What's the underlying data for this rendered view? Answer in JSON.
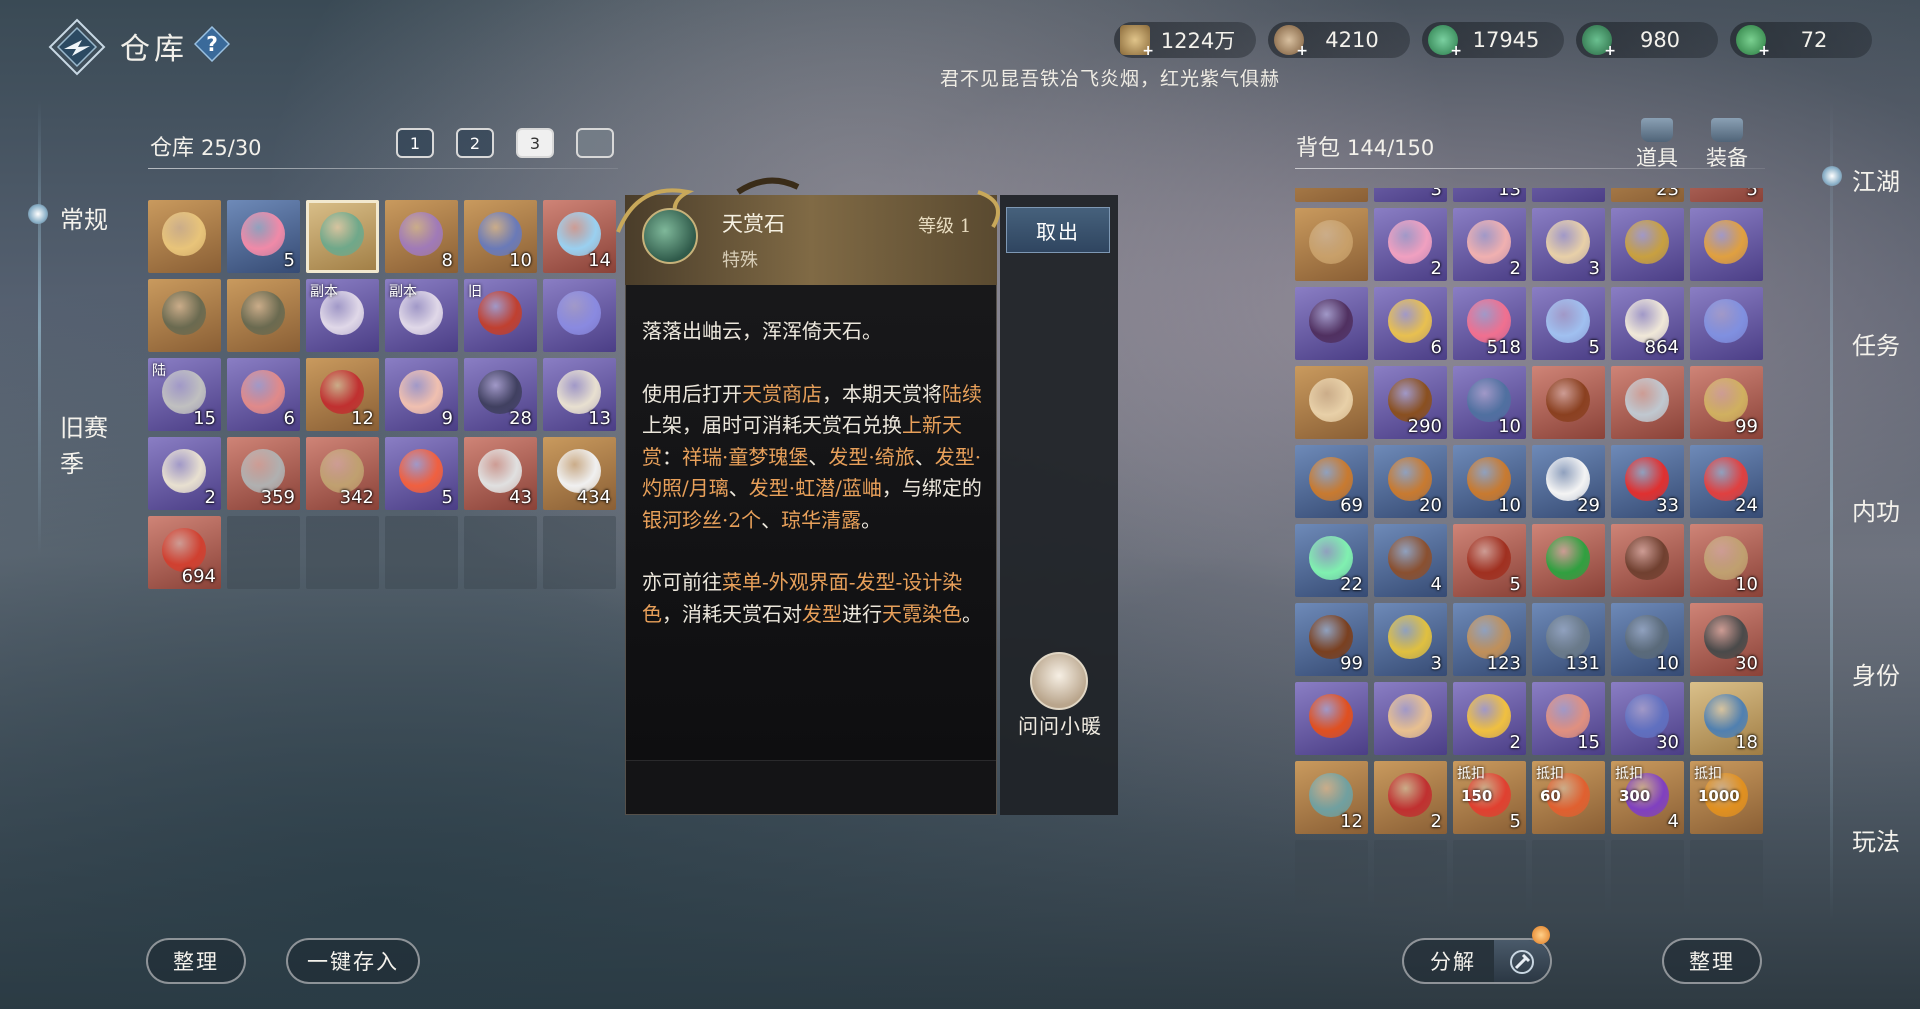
{
  "header": {
    "title": "仓库",
    "help_icon": "question-icon",
    "currencies": [
      {
        "name": "scroll-currency-icon",
        "value": "1224万",
        "color": "#c6a26a"
      },
      {
        "name": "coin-currency-icon",
        "value": "4210",
        "color": "#a98b6a"
      },
      {
        "name": "jade-currency-icon-1",
        "value": "17945",
        "color": "#3d9a6a"
      },
      {
        "name": "jade-currency-icon-2",
        "value": "980",
        "color": "#3d8a5a"
      },
      {
        "name": "jade-currency-icon-3",
        "value": "72",
        "color": "#4a9a5a"
      }
    ],
    "poem": "君不见昆吾铁冶飞炎烟，红光紫气俱赫"
  },
  "left_nav": {
    "items": [
      {
        "label": "常规",
        "active": true
      },
      {
        "label": "旧赛季"
      }
    ]
  },
  "warehouse": {
    "label": "仓库",
    "count": "25/30",
    "tabs": [
      "1",
      "2",
      "3",
      ""
    ],
    "slots": [
      {
        "rarity": "orange",
        "icon": "ring-icon",
        "qty": "",
        "color": "#e8c47a"
      },
      {
        "rarity": "blue",
        "icon": "hearts-icon",
        "qty": "5",
        "color": "#f08aa8"
      },
      {
        "rarity": "gold",
        "icon": "tianshang-stone-icon",
        "qty": "",
        "selected": true,
        "color": "#6fa88a"
      },
      {
        "rarity": "orange",
        "icon": "token-icon",
        "qty": "8",
        "color": "#a07ab8"
      },
      {
        "rarity": "orange",
        "icon": "badge-icon",
        "qty": "10",
        "color": "#6a7ab8"
      },
      {
        "rarity": "red",
        "icon": "crystal-icon",
        "qty": "14",
        "color": "#9ad0f0"
      },
      {
        "rarity": "orange",
        "icon": "ore-icon",
        "qty": "",
        "color": "#6a6a50"
      },
      {
        "rarity": "orange",
        "icon": "ore-icon",
        "qty": "",
        "color": "#6a6a50"
      },
      {
        "rarity": "purple",
        "icon": "robe-icon",
        "qty": "",
        "tag": "副本",
        "color": "#e0d8e8"
      },
      {
        "rarity": "purple",
        "icon": "robe-icon",
        "qty": "",
        "tag": "副本",
        "color": "#e0d8e8"
      },
      {
        "rarity": "purple",
        "icon": "pouch-icon",
        "qty": "",
        "tag": "旧",
        "color": "#c04030"
      },
      {
        "rarity": "purple",
        "icon": "orb-icon",
        "qty": "",
        "color": "#8a8ae0"
      },
      {
        "rarity": "purple",
        "icon": "lantern-icon",
        "qty": "15",
        "tag": "陆",
        "color": "#c0c0c0"
      },
      {
        "rarity": "purple",
        "icon": "scroll-icon",
        "qty": "6",
        "color": "#e08a8a"
      },
      {
        "rarity": "orange",
        "icon": "envelope-icon",
        "qty": "12",
        "color": "#c03030"
      },
      {
        "rarity": "purple",
        "icon": "pearl-icon",
        "qty": "9",
        "color": "#f0c0b0"
      },
      {
        "rarity": "purple",
        "icon": "book-icon",
        "qty": "28",
        "color": "#404060"
      },
      {
        "rarity": "purple",
        "icon": "book-icon",
        "qty": "13",
        "color": "#e8e0d0"
      },
      {
        "rarity": "purple",
        "icon": "book-icon",
        "qty": "2",
        "color": "#e8e0d0"
      },
      {
        "rarity": "red",
        "icon": "book-icon",
        "qty": "359",
        "color": "#b0b0b0"
      },
      {
        "rarity": "red",
        "icon": "bowl-icon",
        "qty": "342",
        "color": "#c0a070"
      },
      {
        "rarity": "purple",
        "icon": "lotus-icon",
        "qty": "5",
        "color": "#f06040"
      },
      {
        "rarity": "red",
        "icon": "fish-icon",
        "qty": "43",
        "color": "#e0e0e0"
      },
      {
        "rarity": "orange",
        "icon": "crane-icon",
        "qty": "434",
        "color": "#f0f0f0"
      },
      {
        "rarity": "red",
        "icon": "gourd-icon",
        "qty": "694",
        "color": "#d04030"
      },
      {
        "empty": true
      },
      {
        "empty": true
      },
      {
        "empty": true
      },
      {
        "empty": true
      },
      {
        "empty": true
      }
    ]
  },
  "tooltip": {
    "name": "天赏石",
    "type": "特殊",
    "level": "等级 1",
    "take_out": "取出",
    "para1": "落落出岫云，浑浑倚天石。",
    "para2_segments": [
      {
        "t": "使用后打开"
      },
      {
        "t": "天赏商店",
        "c": "orange"
      },
      {
        "t": "，本期天赏将"
      },
      {
        "t": "陆续",
        "c": "orange"
      },
      {
        "t": "上架，届时可消耗天赏石兑换"
      },
      {
        "t": "上新天赏",
        "c": "orange"
      },
      {
        "t": "："
      },
      {
        "t": "祥瑞·童梦瑰堡",
        "c": "orange"
      },
      {
        "t": "、"
      },
      {
        "t": "发型·绮旅",
        "c": "orange"
      },
      {
        "t": "、"
      },
      {
        "t": "发型·灼照/月璃",
        "c": "orange"
      },
      {
        "t": "、"
      },
      {
        "t": "发型·虹潜/蓝岫",
        "c": "orange"
      },
      {
        "t": "，与绑定的"
      },
      {
        "t": "银河珍丝·2个",
        "c": "orange"
      },
      {
        "t": "、"
      },
      {
        "t": "琼华清露",
        "c": "orange"
      },
      {
        "t": "。"
      }
    ],
    "para3_segments": [
      {
        "t": "亦可前往"
      },
      {
        "t": "菜单-外观界面-发型-设计染色",
        "c": "orange"
      },
      {
        "t": "，消耗天赏石对"
      },
      {
        "t": "发型",
        "c": "orange"
      },
      {
        "t": "进行"
      },
      {
        "t": "天霓染色",
        "c": "orange"
      },
      {
        "t": "。"
      }
    ],
    "ask_label": "问问小暖"
  },
  "bag": {
    "label": "背包",
    "count": "144/150",
    "tabs": [
      "道具",
      "装备"
    ],
    "top_partial_qty": [
      "",
      "3",
      "13",
      "",
      "23",
      "5"
    ],
    "slots": [
      {
        "rarity": "orange",
        "icon": "paper-icon",
        "qty": "",
        "color": "#c8a06a"
      },
      {
        "rarity": "purple",
        "icon": "crystal-ball-icon",
        "qty": "2",
        "color": "#f0a0c0"
      },
      {
        "rarity": "purple",
        "icon": "crystal-ball-icon",
        "qty": "2",
        "color": "#f0b0b0"
      },
      {
        "rarity": "purple",
        "icon": "scroll-icon",
        "qty": "3",
        "color": "#e8d0a8"
      },
      {
        "rarity": "purple",
        "icon": "money-bag-icon",
        "qty": "",
        "color": "#c8a040"
      },
      {
        "rarity": "purple",
        "icon": "charm-icon",
        "qty": "",
        "color": "#e0a040"
      },
      {
        "rarity": "purple",
        "icon": "box-icon",
        "qty": "",
        "color": "#503060"
      },
      {
        "rarity": "purple",
        "icon": "gold-coin-icon",
        "qty": "6",
        "color": "#e8c050"
      },
      {
        "rarity": "purple",
        "icon": "pink-orb-icon",
        "qty": "518",
        "color": "#f07090"
      },
      {
        "rarity": "purple",
        "icon": "gem-icon",
        "qty": "5",
        "color": "#a0c0f0"
      },
      {
        "rarity": "purple",
        "icon": "mask-icon",
        "qty": "864",
        "color": "#f0e8d8"
      },
      {
        "rarity": "purple",
        "icon": "ticket-icon",
        "qty": "",
        "color": "#8090e0"
      },
      {
        "rarity": "orange",
        "icon": "scroll-icon",
        "qty": "",
        "color": "#e8d0a8"
      },
      {
        "rarity": "purple",
        "icon": "chest-icon",
        "qty": "290",
        "color": "#8a5020"
      },
      {
        "rarity": "purple",
        "icon": "book-icon",
        "qty": "10",
        "color": "#5070a0"
      },
      {
        "rarity": "red",
        "icon": "bowl-icon",
        "qty": "",
        "color": "#8a4020"
      },
      {
        "rarity": "red",
        "icon": "vase-icon",
        "qty": "",
        "color": "#c0c8d0"
      },
      {
        "rarity": "red",
        "icon": "brush-icon",
        "qty": "99",
        "color": "#d0b060"
      },
      {
        "rarity": "blue",
        "icon": "seal-icon",
        "qty": "69",
        "color": "#c87a30"
      },
      {
        "rarity": "blue",
        "icon": "seal-icon",
        "qty": "20",
        "color": "#c87a30"
      },
      {
        "rarity": "blue",
        "icon": "seal-icon",
        "qty": "10",
        "color": "#c87a30"
      },
      {
        "rarity": "blue",
        "icon": "face-icon",
        "qty": "29",
        "color": "#f4f4f4"
      },
      {
        "rarity": "blue",
        "icon": "firework-icon",
        "qty": "33",
        "color": "#e03030"
      },
      {
        "rarity": "blue",
        "icon": "demon-icon",
        "qty": "24",
        "color": "#e04040"
      },
      {
        "rarity": "blue",
        "icon": "glowstick-icon",
        "qty": "22",
        "color": "#80f0b0"
      },
      {
        "rarity": "blue",
        "icon": "wood-icon",
        "qty": "4",
        "color": "#8a5030"
      },
      {
        "rarity": "red",
        "icon": "tag-icon",
        "qty": "5",
        "color": "#a03020"
      },
      {
        "rarity": "red",
        "icon": "holly-icon",
        "qty": "",
        "color": "#30a040"
      },
      {
        "rarity": "red",
        "icon": "branch-icon",
        "qty": "",
        "color": "#704030"
      },
      {
        "rarity": "red",
        "icon": "bowl-icon",
        "qty": "10",
        "color": "#c0a070"
      },
      {
        "rarity": "blue",
        "icon": "bowl-icon",
        "qty": "99",
        "color": "#7a4020"
      },
      {
        "rarity": "blue",
        "icon": "candy-icon",
        "qty": "3",
        "color": "#e0c040"
      },
      {
        "rarity": "blue",
        "icon": "compass-icon",
        "qty": "123",
        "color": "#c0905a"
      },
      {
        "rarity": "blue",
        "icon": "crystal-rock-icon",
        "qty": "131",
        "color": "#6a7a8a"
      },
      {
        "rarity": "blue",
        "icon": "crystal-rock-icon",
        "qty": "10",
        "color": "#5a6a7a"
      },
      {
        "rarity": "red",
        "icon": "rock-icon",
        "qty": "30",
        "color": "#4a4a4a"
      },
      {
        "rarity": "purple",
        "icon": "flame-crystal-icon",
        "qty": "",
        "color": "#e05020"
      },
      {
        "rarity": "purple",
        "icon": "voucher-icon",
        "qty": "",
        "color": "#e8c090"
      },
      {
        "rarity": "purple",
        "icon": "gold-crystal-icon",
        "qty": "2",
        "color": "#f0c040"
      },
      {
        "rarity": "purple",
        "icon": "talisman-icon",
        "qty": "15",
        "color": "#e09080"
      },
      {
        "rarity": "purple",
        "icon": "eye-orb-icon",
        "qty": "30",
        "color": "#6070c0"
      },
      {
        "rarity": "gold",
        "icon": "tome-icon",
        "qty": "18",
        "color": "#5080b0"
      },
      {
        "rarity": "orange",
        "icon": "map-icon",
        "qty": "12",
        "color": "#70a0a0"
      },
      {
        "rarity": "orange",
        "icon": "envelope-icon",
        "qty": "2",
        "color": "#c03030"
      },
      {
        "rarity": "orange",
        "icon": "coupon-icon",
        "qty": "5",
        "tag": "抵扣",
        "coupon": "150",
        "color": "#e04030"
      },
      {
        "rarity": "orange",
        "icon": "coupon-icon",
        "qty": "",
        "tag": "抵扣",
        "coupon": "60",
        "color": "#e06030"
      },
      {
        "rarity": "orange",
        "icon": "coupon-icon",
        "qty": "4",
        "tag": "抵扣",
        "coupon": "300",
        "color": "#8040c0"
      },
      {
        "rarity": "orange",
        "icon": "coupon-icon",
        "qty": "",
        "tag": "抵扣",
        "coupon": "1000",
        "color": "#e09020"
      },
      {
        "empty": true
      },
      {
        "empty": true
      },
      {
        "empty": true
      },
      {
        "empty": true
      },
      {
        "empty": true
      },
      {
        "empty": true
      }
    ]
  },
  "right_nav": {
    "items": [
      "江湖",
      "任务",
      "内功",
      "身份",
      "玩法"
    ]
  },
  "buttons": {
    "wh_sort": "整理",
    "deposit_all": "一键存入",
    "decompose": "分解",
    "bag_sort": "整理"
  }
}
